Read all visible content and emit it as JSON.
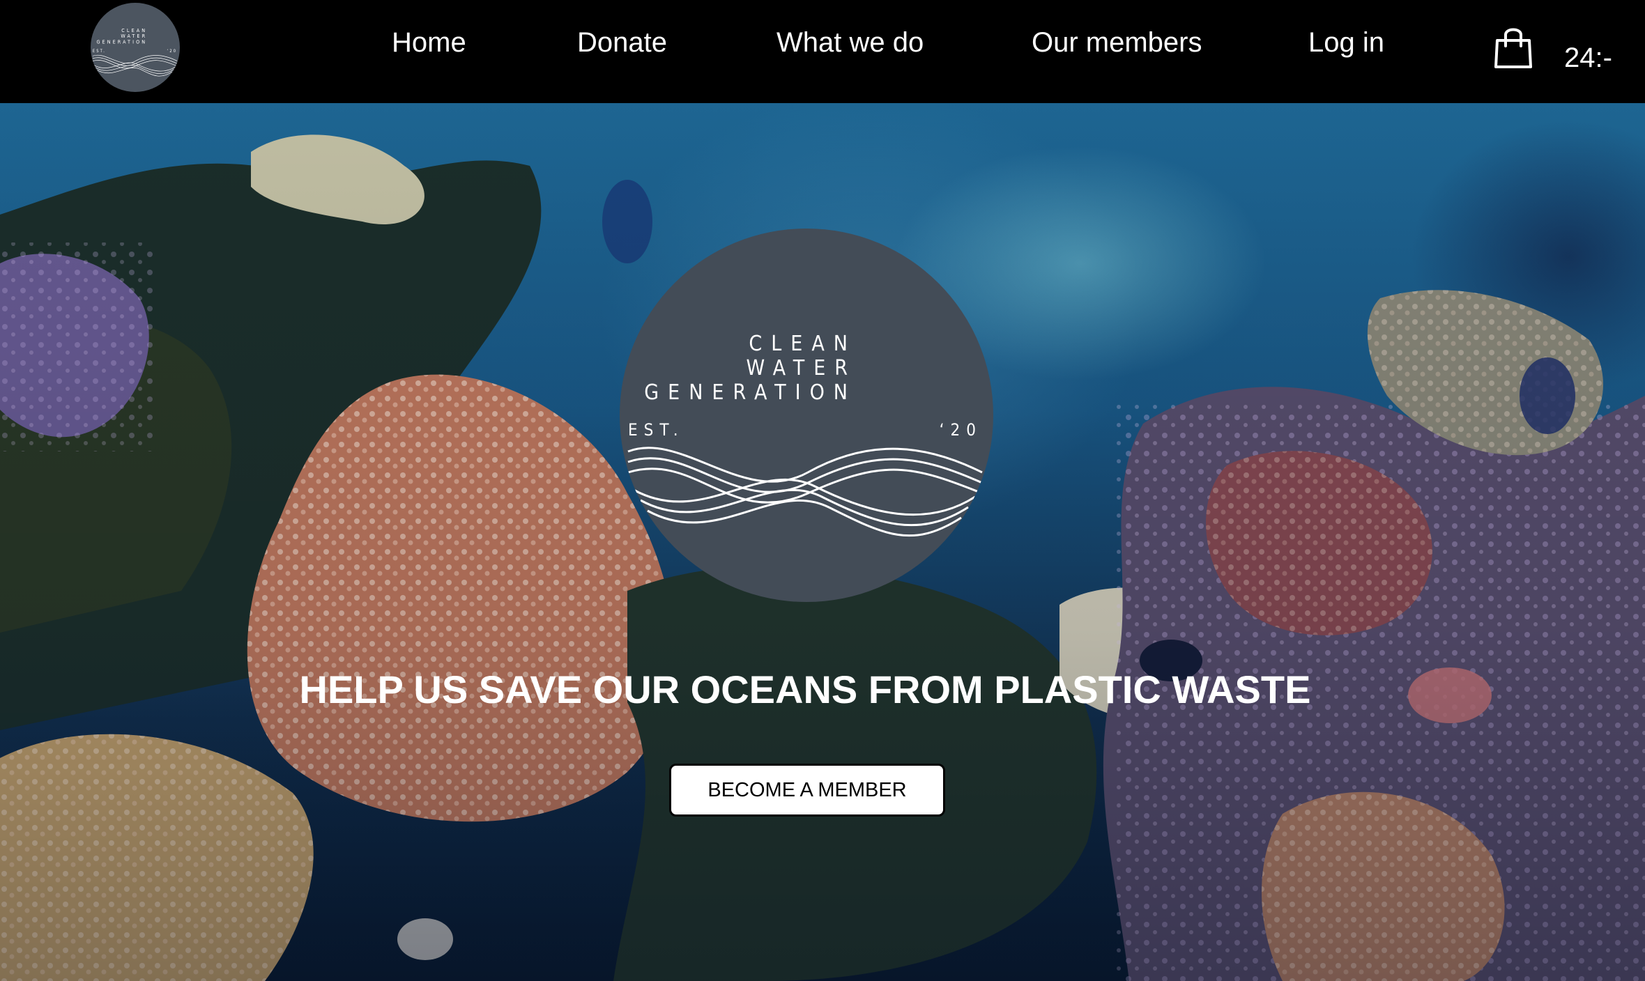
{
  "brand": {
    "line1": "CLEAN",
    "line2": "WATER",
    "line3": "GENERATION",
    "est": "EST.",
    "year": "‘20"
  },
  "nav": {
    "items": [
      {
        "label": "Home"
      },
      {
        "label": "Donate"
      },
      {
        "label": "What we do"
      },
      {
        "label": "Our members"
      },
      {
        "label": "Log in"
      }
    ],
    "cart_total": "24:-"
  },
  "hero": {
    "heading": "HELP US SAVE OUR OCEANS FROM PLASTIC WASTE",
    "cta_label": "BECOME A MEMBER",
    "background": "underwater-coral-reef-photo"
  },
  "colors": {
    "header_bg": "#000000",
    "logo_circle": "#434c57",
    "text_light": "#ffffff",
    "button_bg": "#ffffff"
  },
  "icons": {
    "cart": "shopping-bag-icon"
  }
}
